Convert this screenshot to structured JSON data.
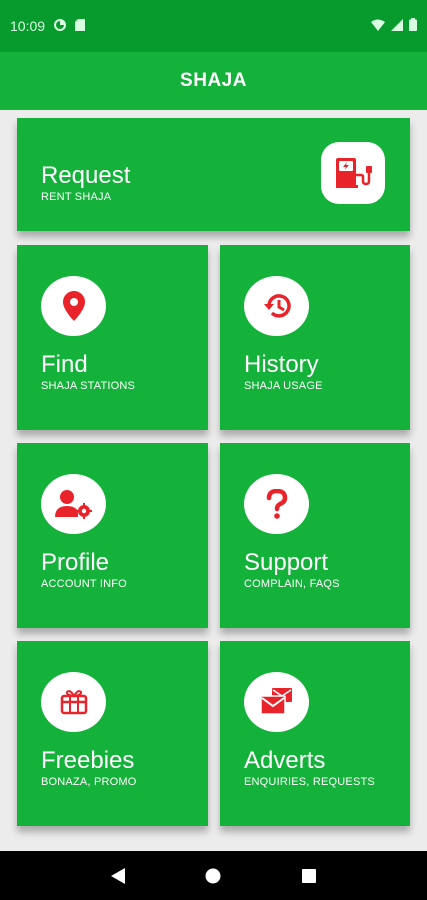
{
  "status_bar": {
    "time": "10:09"
  },
  "app_bar": {
    "title": "SHAJA"
  },
  "tiles": {
    "request": {
      "title": "Request",
      "subtitle": "RENT SHAJA",
      "icon": "ev-charger-icon"
    },
    "find": {
      "title": "Find",
      "subtitle": "SHAJA STATIONS",
      "icon": "location-pin-icon"
    },
    "history": {
      "title": "History",
      "subtitle": "SHAJA USAGE",
      "icon": "history-icon"
    },
    "profile": {
      "title": "Profile",
      "subtitle": "ACCOUNT INFO",
      "icon": "user-settings-icon"
    },
    "support": {
      "title": "Support",
      "subtitle": "COMPLAIN, FAQs",
      "icon": "question-icon"
    },
    "freebies": {
      "title": "Freebies",
      "subtitle": "BONAZA, PROMO",
      "icon": "gift-icon"
    },
    "adverts": {
      "title": "Adverts",
      "subtitle": "ENQUIRIES, REQUESTS",
      "icon": "mail-icon"
    }
  },
  "colors": {
    "primary": "#14b23a",
    "status": "#079b2d",
    "icon_red": "#e8232a",
    "background": "#ececec"
  }
}
